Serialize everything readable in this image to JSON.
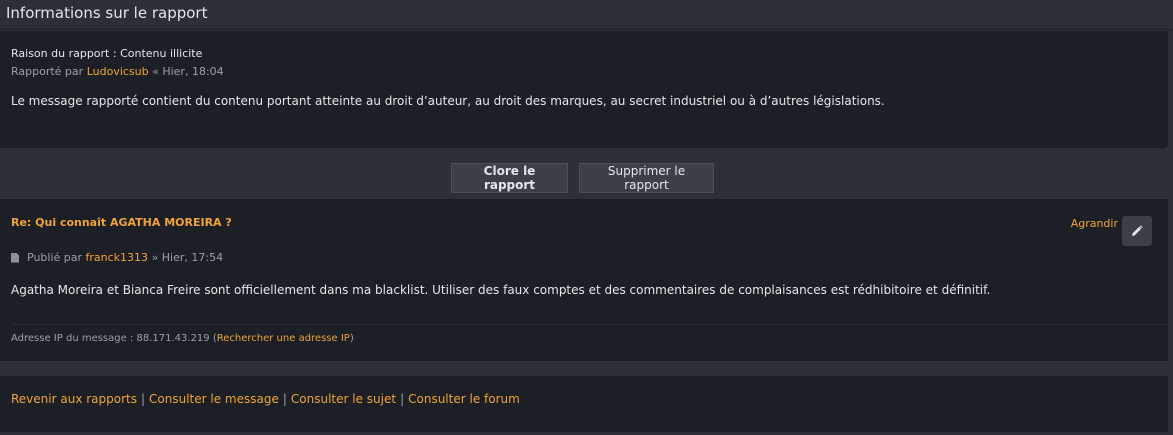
{
  "header": {
    "title": "Informations sur le rapport"
  },
  "report": {
    "reason_label": "Raison du rapport : Contenu illicite",
    "reported_by_prefix": "Rapporté par",
    "reporter": "Ludovicsub",
    "reported_time": "« Hier, 18:04",
    "body": "Le message rapporté contient du contenu portant atteinte au droit d’auteur, au droit des marques, au secret industriel ou à d’autres législations."
  },
  "actions": {
    "close_label": "Clore le rapport",
    "delete_label": "Supprimer le rapport"
  },
  "post": {
    "title": "Re: Qui connaît AGATHA MOREIRA ?",
    "expand_label": "Agrandir",
    "published_prefix": "Publié par",
    "author": "franck1313",
    "published_time": "» Hier, 17:54",
    "body": "Agatha Moreira et Bianca Freire sont officiellement dans ma blacklist. Utiliser des faux comptes et des commentaires de complaisances est rédhibitoire et définitif.",
    "ip_label": "Adresse IP du message : 88.171.43.219 (",
    "ip_search_link": "Rechercher une adresse IP",
    "ip_suffix": ")"
  },
  "footer": {
    "links": [
      "Revenir aux rapports",
      "Consulter le message",
      "Consulter le sujet",
      "Consulter le forum"
    ]
  },
  "colors": {
    "accent": "#f0a33a",
    "panel": "#1c1f25",
    "background": "#2b2f36"
  }
}
